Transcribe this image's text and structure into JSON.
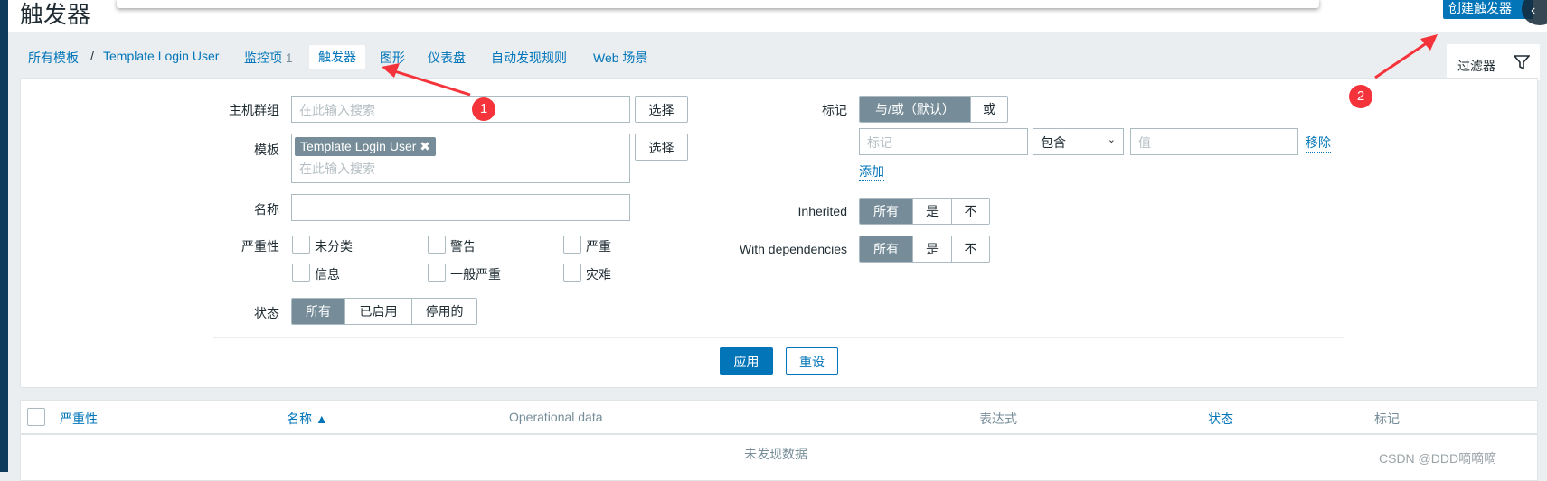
{
  "header": {
    "title": "触发器",
    "create_button": "创建触发器",
    "collapse_icon": "‹"
  },
  "nav": {
    "breadcrumb": [
      "所有模板",
      "Template Login User"
    ],
    "separator": "/",
    "items": [
      {
        "label": "监控项",
        "count": "1"
      },
      {
        "label": "触发器",
        "active": true
      },
      {
        "label": "图形"
      },
      {
        "label": "仪表盘"
      },
      {
        "label": "自动发现规则"
      },
      {
        "label": "Web 场景"
      }
    ],
    "filter_tab": "过滤器"
  },
  "filter": {
    "host_group": {
      "label": "主机群组",
      "placeholder": "在此输入搜索",
      "select": "选择"
    },
    "template": {
      "label": "模板",
      "chip": "Template Login User",
      "placeholder": "在此输入搜索",
      "select": "选择"
    },
    "name": {
      "label": "名称",
      "value": ""
    },
    "severity": {
      "label": "严重性",
      "options": [
        "未分类",
        "警告",
        "严重",
        "信息",
        "一般严重",
        "灾难"
      ]
    },
    "status": {
      "label": "状态",
      "options": [
        "所有",
        "已启用",
        "停用的"
      ],
      "selected": "所有"
    },
    "tags": {
      "label": "标记",
      "modes": [
        "与/或（默认）",
        "或"
      ],
      "selected": "与/或（默认）",
      "tag_placeholder": "标记",
      "operator": "包含",
      "value_placeholder": "值",
      "remove": "移除",
      "add": "添加"
    },
    "inherited": {
      "label": "Inherited",
      "options": [
        "所有",
        "是",
        "不"
      ],
      "selected": "所有"
    },
    "with_dependencies": {
      "label": "With dependencies",
      "options": [
        "所有",
        "是",
        "不"
      ],
      "selected": "所有"
    },
    "apply": "应用",
    "reset": "重设"
  },
  "table": {
    "columns": [
      "严重性",
      "名称 ▲",
      "Operational data",
      "表达式",
      "状态",
      "标记"
    ],
    "empty": "未发现数据"
  },
  "annotations": [
    "1",
    "2"
  ],
  "watermark": "CSDN @DDD嘀嘀嘀",
  "colors": {
    "accent": "#0275b8",
    "segment_active": "#768d99",
    "annotation": "#f5333b"
  }
}
